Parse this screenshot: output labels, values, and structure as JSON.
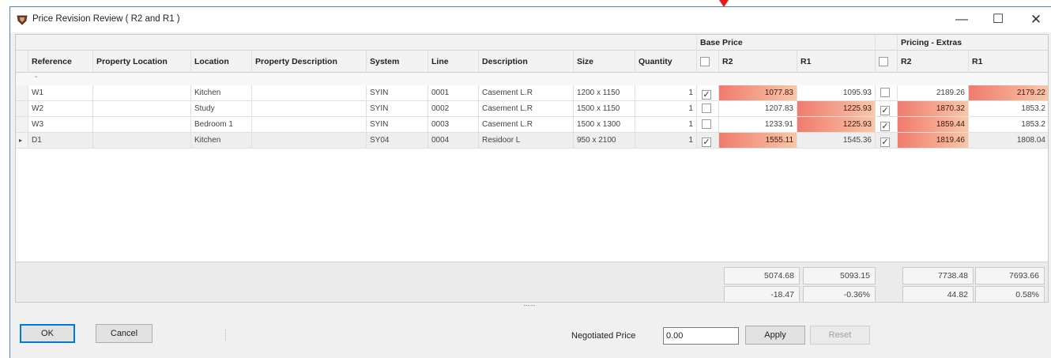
{
  "window": {
    "title": "Price Revision Review ( R2 and R1 )",
    "controls": {
      "minimize": "—",
      "maximize": "☐",
      "close": "✕"
    }
  },
  "grid": {
    "bands": {
      "base_price": "Base Price",
      "pricing_extras": "Pricing - Extras"
    },
    "columns": {
      "reference": "Reference",
      "property_location": "Property Location",
      "location": "Location",
      "property_description": "Property Description",
      "system": "System",
      "line": "Line",
      "description": "Description",
      "size": "Size",
      "quantity": "Quantity",
      "base_r2": "R2",
      "base_r1": "R1",
      "extras_r2": "R2",
      "extras_r1": "R1"
    },
    "group_row_glyph": "-",
    "rows": [
      {
        "reference": "W1",
        "property_location": "",
        "location": "Kitchen",
        "property_description": "",
        "system": "SYIN",
        "line": "0001",
        "description": "Casement L.R",
        "size": "1200 x 1150",
        "quantity": "1",
        "base_checked": true,
        "base_r2": "1077.83",
        "base_r1": "1095.93",
        "extras_checked": false,
        "extras_r2": "2189.26",
        "extras_r1": "2179.22",
        "base_highlight": "r2",
        "extras_highlight": "r1"
      },
      {
        "reference": "W2",
        "property_location": "",
        "location": "Study",
        "property_description": "",
        "system": "SYIN",
        "line": "0002",
        "description": "Casement L.R",
        "size": "1500 x 1150",
        "quantity": "1",
        "base_checked": false,
        "base_r2": "1207.83",
        "base_r1": "1225.93",
        "extras_checked": true,
        "extras_r2": "1870.32",
        "extras_r1": "1853.2",
        "base_highlight": "r1",
        "extras_highlight": "r2"
      },
      {
        "reference": "W3",
        "property_location": "",
        "location": "Bedroom 1",
        "property_description": "",
        "system": "SYIN",
        "line": "0003",
        "description": "Casement L.R",
        "size": "1500 x 1300",
        "quantity": "1",
        "base_checked": false,
        "base_r2": "1233.91",
        "base_r1": "1225.93",
        "extras_checked": true,
        "extras_r2": "1859.44",
        "extras_r1": "1853.2",
        "base_highlight": "r1",
        "extras_highlight": "r2"
      },
      {
        "reference": "D1",
        "property_location": "",
        "location": "Kitchen",
        "property_description": "",
        "system": "SY04",
        "line": "0004",
        "description": "Residoor L",
        "size": "950 x 2100",
        "quantity": "1",
        "base_checked": true,
        "base_r2": "1555.11",
        "base_r1": "1545.36",
        "extras_checked": true,
        "extras_r2": "1819.46",
        "extras_r1": "1808.04",
        "base_highlight": "r2",
        "extras_highlight": "r2",
        "selected": true
      }
    ],
    "current_row_indicator": "▸",
    "totals": {
      "base_r2": "5074.68",
      "base_r1": "5093.15",
      "extras_r2": "7738.48",
      "extras_r1": "7693.66",
      "base_diff": "-18.47",
      "base_pct": "-0.36%",
      "extras_diff": "44.82",
      "extras_pct": "0.58%"
    }
  },
  "footer": {
    "ok_label": "OK",
    "cancel_label": "Cancel",
    "negotiated_label": "Negotiated Price",
    "negotiated_value": "0.00",
    "apply_label": "Apply",
    "reset_label": "Reset"
  },
  "colors": {
    "highlight_strong": "#f07b6e",
    "highlight_light": "#f9c7a8",
    "window_border": "#5a7fb0",
    "marker": "#e31b1b"
  },
  "icons": {
    "app": "shield-icon",
    "check": "check-icon"
  }
}
